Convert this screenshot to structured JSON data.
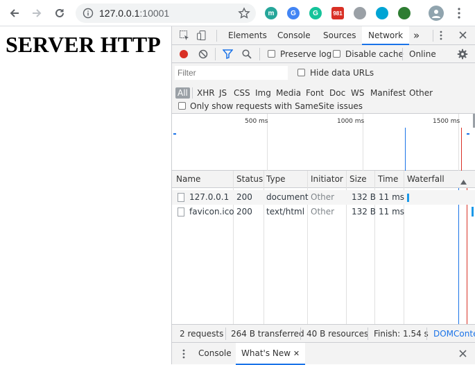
{
  "browser": {
    "url_host": "127.0.0.1",
    "url_port": ":10001",
    "extensions": [
      {
        "name": "m-extension-icon",
        "label": "m",
        "color": "#26a69a"
      },
      {
        "name": "translate-extension-icon",
        "label": "G",
        "color": "#4285f4"
      },
      {
        "name": "grammarly-extension-icon",
        "label": "G",
        "color": "#15c39a"
      },
      {
        "name": "gmail-extension-icon",
        "label": "981",
        "color": "#d93025"
      },
      {
        "name": "shield-extension-icon",
        "label": "",
        "color": "#9aa0a6"
      },
      {
        "name": "circle-extension-icon",
        "label": "",
        "color": "#00a4d4"
      },
      {
        "name": "globe-extension-icon",
        "label": "",
        "color": "#2e7d32"
      }
    ]
  },
  "page": {
    "heading": "SERVER HTTP"
  },
  "devtools": {
    "tabs": [
      "Elements",
      "Console",
      "Sources",
      "Network"
    ],
    "active_tab": "Network",
    "more_tabs": "»",
    "toolbar": {
      "preserve_log": "Preserve log",
      "disable_cache": "Disable cache",
      "throttling": "Online"
    },
    "filter": {
      "placeholder": "Filter",
      "hide_data_urls": "Hide data URLs",
      "types": [
        "All",
        "XHR",
        "JS",
        "CSS",
        "Img",
        "Media",
        "Font",
        "Doc",
        "WS",
        "Manifest",
        "Other"
      ],
      "same_site": "Only show requests with SameSite issues"
    },
    "overview_ticks": [
      "500 ms",
      "1000 ms",
      "1500 ms"
    ],
    "columns": [
      "Name",
      "Status",
      "Type",
      "Initiator",
      "Size",
      "Time",
      "Waterfall"
    ],
    "rows": [
      {
        "name": "127.0.0.1",
        "status": "200",
        "type": "document",
        "initiator": "Other",
        "size": "132 B",
        "time": "11 ms"
      },
      {
        "name": "favicon.ico",
        "status": "200",
        "type": "text/html",
        "initiator": "Other",
        "size": "132 B",
        "time": "11 ms"
      }
    ],
    "summary": {
      "requests": "2 requests",
      "transferred": "264 B transferred",
      "resources": "40 B resources",
      "finish": "Finish: 1.54 s",
      "dom": "DOMContentLoaded"
    },
    "drawer": {
      "console": "Console",
      "whats_new": "What's New"
    },
    "colors": {
      "accent": "#1a73e8",
      "record": "#d93025"
    }
  }
}
